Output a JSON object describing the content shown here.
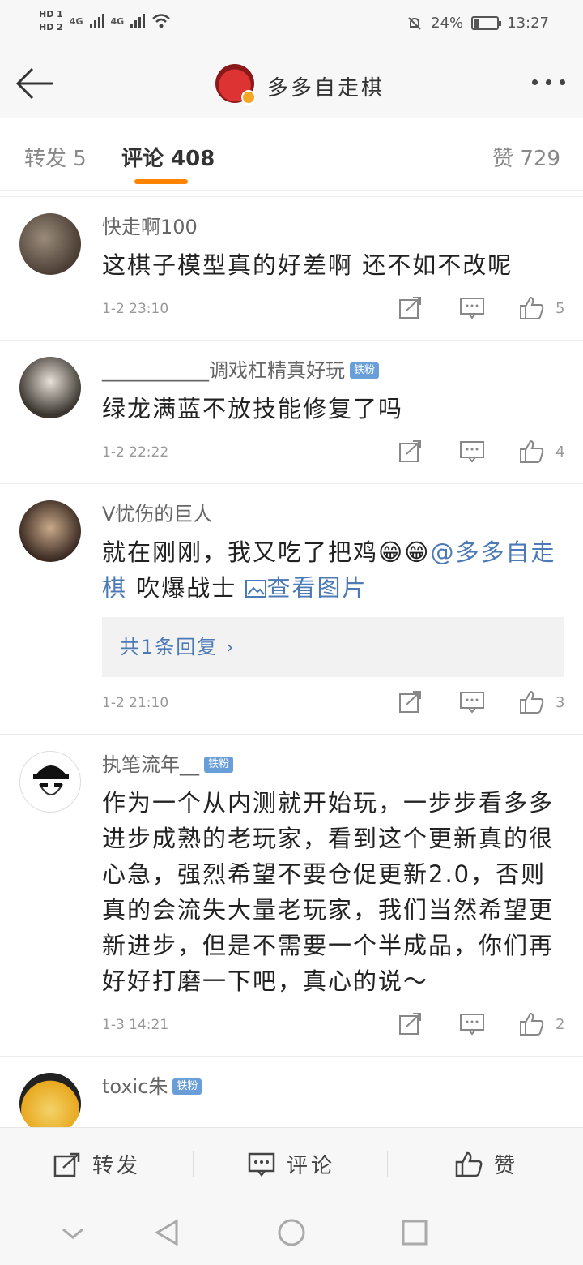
{
  "status": {
    "hd1": "HD 1",
    "hd2": "HD 2",
    "net1": "4G",
    "net2": "4G",
    "battery": "24%",
    "battery_level": 0.24,
    "time": "13:27"
  },
  "header": {
    "title": "多多自走棋"
  },
  "tabs": {
    "repost": "转发 5",
    "comments": "评论 408",
    "likes": "赞 729"
  },
  "comments": [
    {
      "user": "快走啊100",
      "badge": "",
      "text": "这棋子模型真的好差啊 还不如不改呢",
      "time": "1-2 23:10",
      "likes": "5"
    },
    {
      "user": "___________调戏杠精真好玩",
      "badge": "铁粉",
      "text": "绿龙满蓝不放技能修复了吗",
      "time": "1-2 22:22",
      "likes": "4"
    },
    {
      "user": "V忧伤的巨人",
      "badge": "",
      "text_a": "就在刚刚，我又吃了把鸡😁😁",
      "mention": "@多多自走棋",
      "text_b": " 吹爆战士 ",
      "img_link": "查看图片",
      "reply": "共1条回复 ›",
      "time": "1-2 21:10",
      "likes": "3"
    },
    {
      "user": "执笔流年__",
      "badge": "铁粉",
      "text": "作为一个从内测就开始玩，一步步看多多进步成熟的老玩家，看到这个更新真的很心急，强烈希望不要仓促更新2.0，否则真的会流失大量老玩家，我们当然希望更新进步，但是不需要一个半成品，你们再好好打磨一下吧，真心的说～",
      "time": "1-3 14:21",
      "likes": "2"
    },
    {
      "user": "toxic朱",
      "badge": "铁粉"
    }
  ],
  "actionbar": {
    "repost": "转发",
    "comment": "评论",
    "like": "赞"
  }
}
